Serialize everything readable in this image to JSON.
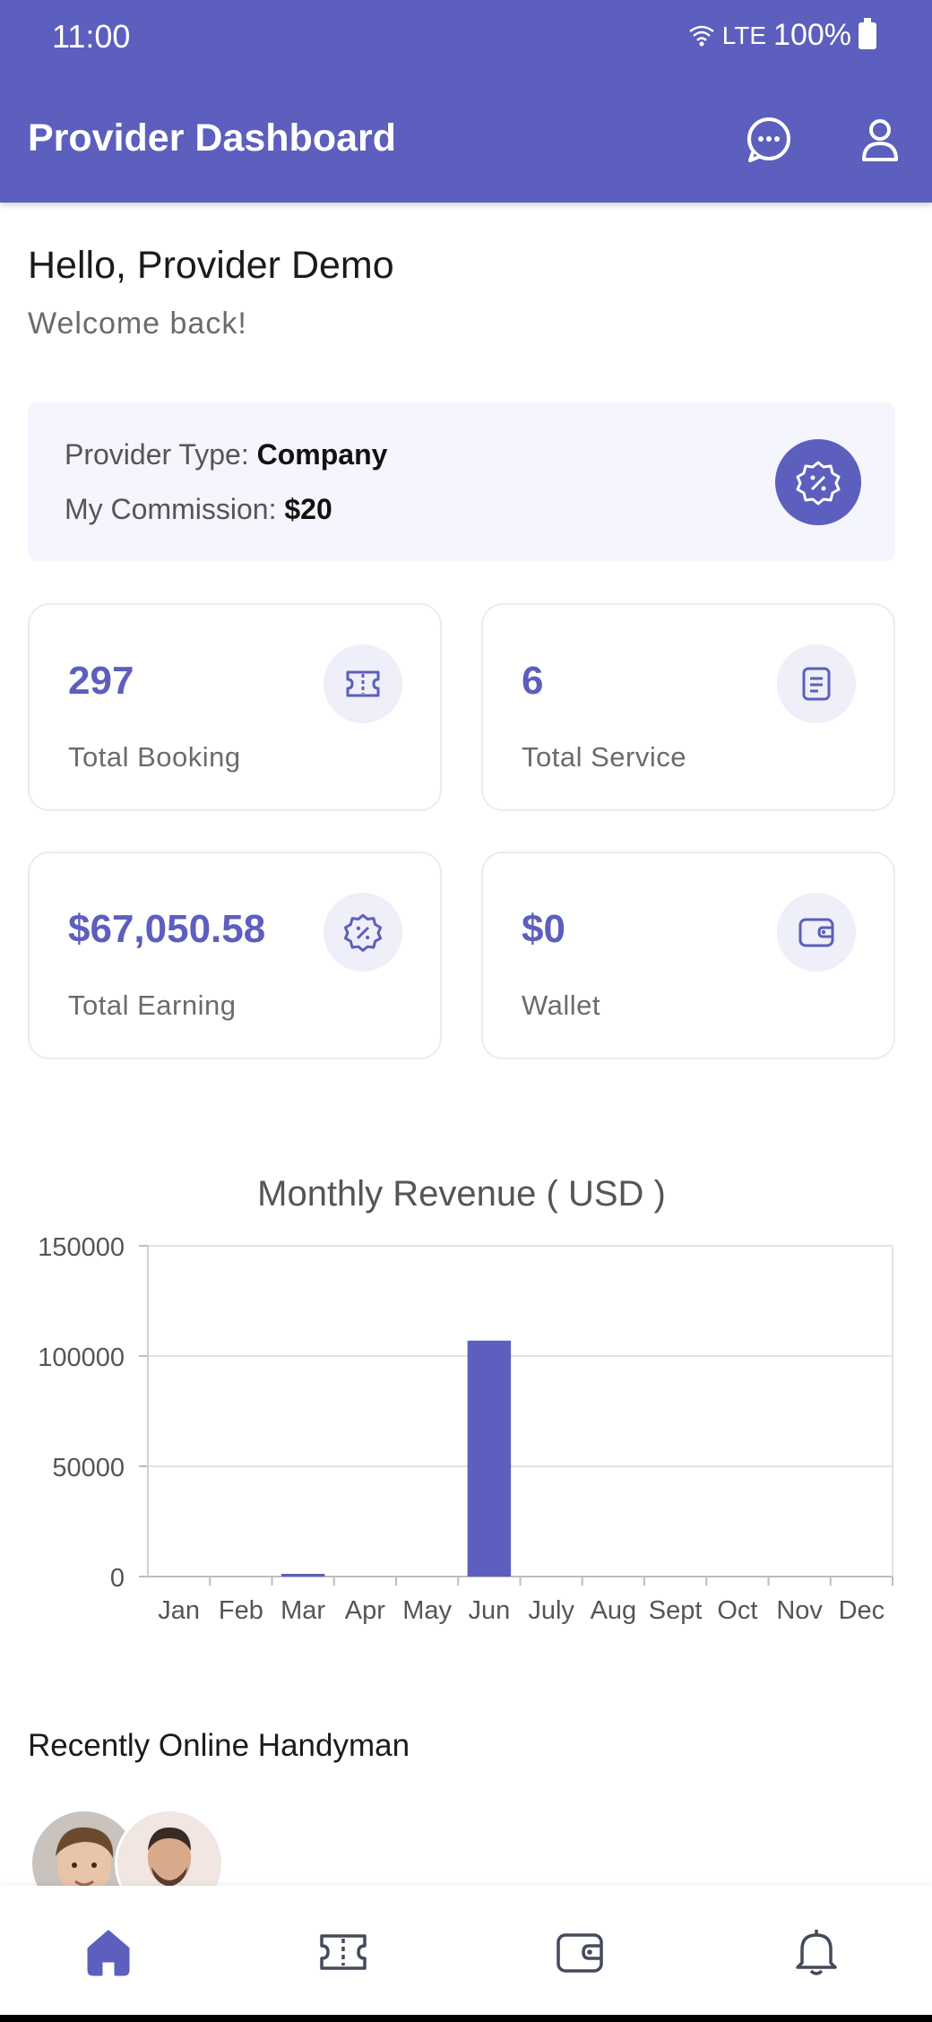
{
  "status_bar": {
    "time": "11:00",
    "network": "LTE",
    "battery": "100%"
  },
  "header": {
    "title": "Provider Dashboard",
    "icons": [
      "chat-icon",
      "profile-icon"
    ]
  },
  "greeting": {
    "hello": "Hello, Provider Demo",
    "subtitle": "Welcome back!"
  },
  "provider_info": {
    "type_label": "Provider Type:",
    "type_value": "Company",
    "commission_label": "My Commission:",
    "commission_value": "$20",
    "badge_icon": "discount-badge-icon"
  },
  "stats": [
    {
      "value": "297",
      "label": "Total Booking",
      "icon": "ticket-icon"
    },
    {
      "value": "6",
      "label": "Total Service",
      "icon": "document-icon"
    },
    {
      "value": "$67,050.58",
      "label": "Total Earning",
      "icon": "discount-badge-icon"
    },
    {
      "value": "$0",
      "label": "Wallet",
      "icon": "wallet-icon"
    }
  ],
  "chart_data": {
    "type": "bar",
    "title": "Monthly Revenue ( USD )",
    "categories": [
      "Jan",
      "Feb",
      "Mar",
      "Apr",
      "May",
      "Jun",
      "July",
      "Aug",
      "Sept",
      "Oct",
      "Nov",
      "Dec"
    ],
    "values": [
      0,
      0,
      900,
      0,
      0,
      107000,
      0,
      0,
      0,
      0,
      0,
      0
    ],
    "ylim": [
      0,
      150000
    ],
    "yticks": [
      "0",
      "50000",
      "100000",
      "150000"
    ],
    "color": "#5c5fbd",
    "grid": true
  },
  "recent_handyman": {
    "title": "Recently Online Handyman",
    "avatars": [
      "handyman-avatar-1",
      "handyman-avatar-2"
    ]
  },
  "bottom_nav": {
    "items": [
      "home-icon",
      "booking-ticket-icon",
      "wallet-icon",
      "notification-bell-icon"
    ],
    "active": "home-icon",
    "active_color": "#5c5fbd",
    "inactive_color": "#444a5a"
  }
}
